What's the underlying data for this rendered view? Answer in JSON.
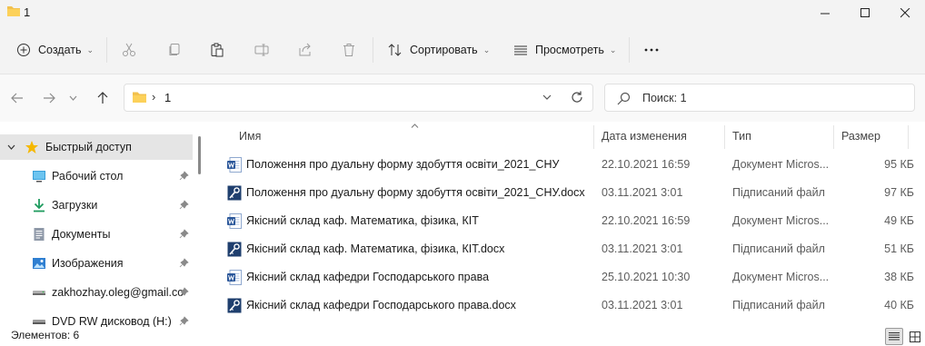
{
  "window": {
    "title": "1"
  },
  "toolbar": {
    "create_label": "Создать",
    "sort_label": "Сортировать",
    "view_label": "Просмотреть"
  },
  "address": {
    "segment": "1"
  },
  "search": {
    "placeholder": "Поиск: 1"
  },
  "sidebar": {
    "items": [
      {
        "label": "Быстрый доступ",
        "icon": "star-icon"
      },
      {
        "label": "Рабочий стол",
        "icon": "desktop-icon"
      },
      {
        "label": "Загрузки",
        "icon": "download-icon"
      },
      {
        "label": "Документы",
        "icon": "documents-icon"
      },
      {
        "label": "Изображения",
        "icon": "pictures-icon"
      },
      {
        "label": "zakhozhay.oleg@gmail.co",
        "icon": "drive-icon"
      },
      {
        "label": "DVD RW дисковод (H:)",
        "icon": "dvd-drive-icon"
      }
    ]
  },
  "columns": {
    "name": "Имя",
    "date": "Дата изменения",
    "type": "Тип",
    "size": "Размер"
  },
  "files": [
    {
      "name": "Положення про дуальну форму здобуття освіти_2021_СНУ",
      "date": "22.10.2021 16:59",
      "type": "Документ Micros...",
      "size": "95 КБ",
      "icon": "word-doc-icon"
    },
    {
      "name": "Положення про дуальну форму здобуття освіти_2021_СНУ.docx",
      "date": "03.11.2021 3:01",
      "type": "Підписаний файл",
      "size": "97 КБ",
      "icon": "signed-file-icon"
    },
    {
      "name": "Якісний склад каф. Математика, фізика, КІТ",
      "date": "22.10.2021 16:59",
      "type": "Документ Micros...",
      "size": "49 КБ",
      "icon": "word-doc-icon"
    },
    {
      "name": "Якісний склад каф. Математика, фізика, КІТ.docx",
      "date": "03.11.2021 3:01",
      "type": "Підписаний файл",
      "size": "51 КБ",
      "icon": "signed-file-icon"
    },
    {
      "name": "Якісний склад кафедри Господарського права",
      "date": "25.10.2021 10:30",
      "type": "Документ Micros...",
      "size": "38 КБ",
      "icon": "word-doc-icon"
    },
    {
      "name": "Якісний склад кафедри Господарського права.docx",
      "date": "03.11.2021 3:01",
      "type": "Підписаний файл",
      "size": "40 КБ",
      "icon": "signed-file-icon"
    }
  ],
  "status": {
    "count": "Элементов: 6"
  },
  "colors": {
    "folder": "#f2c14e",
    "word": "#2b579a",
    "accent": "#0067c0"
  }
}
